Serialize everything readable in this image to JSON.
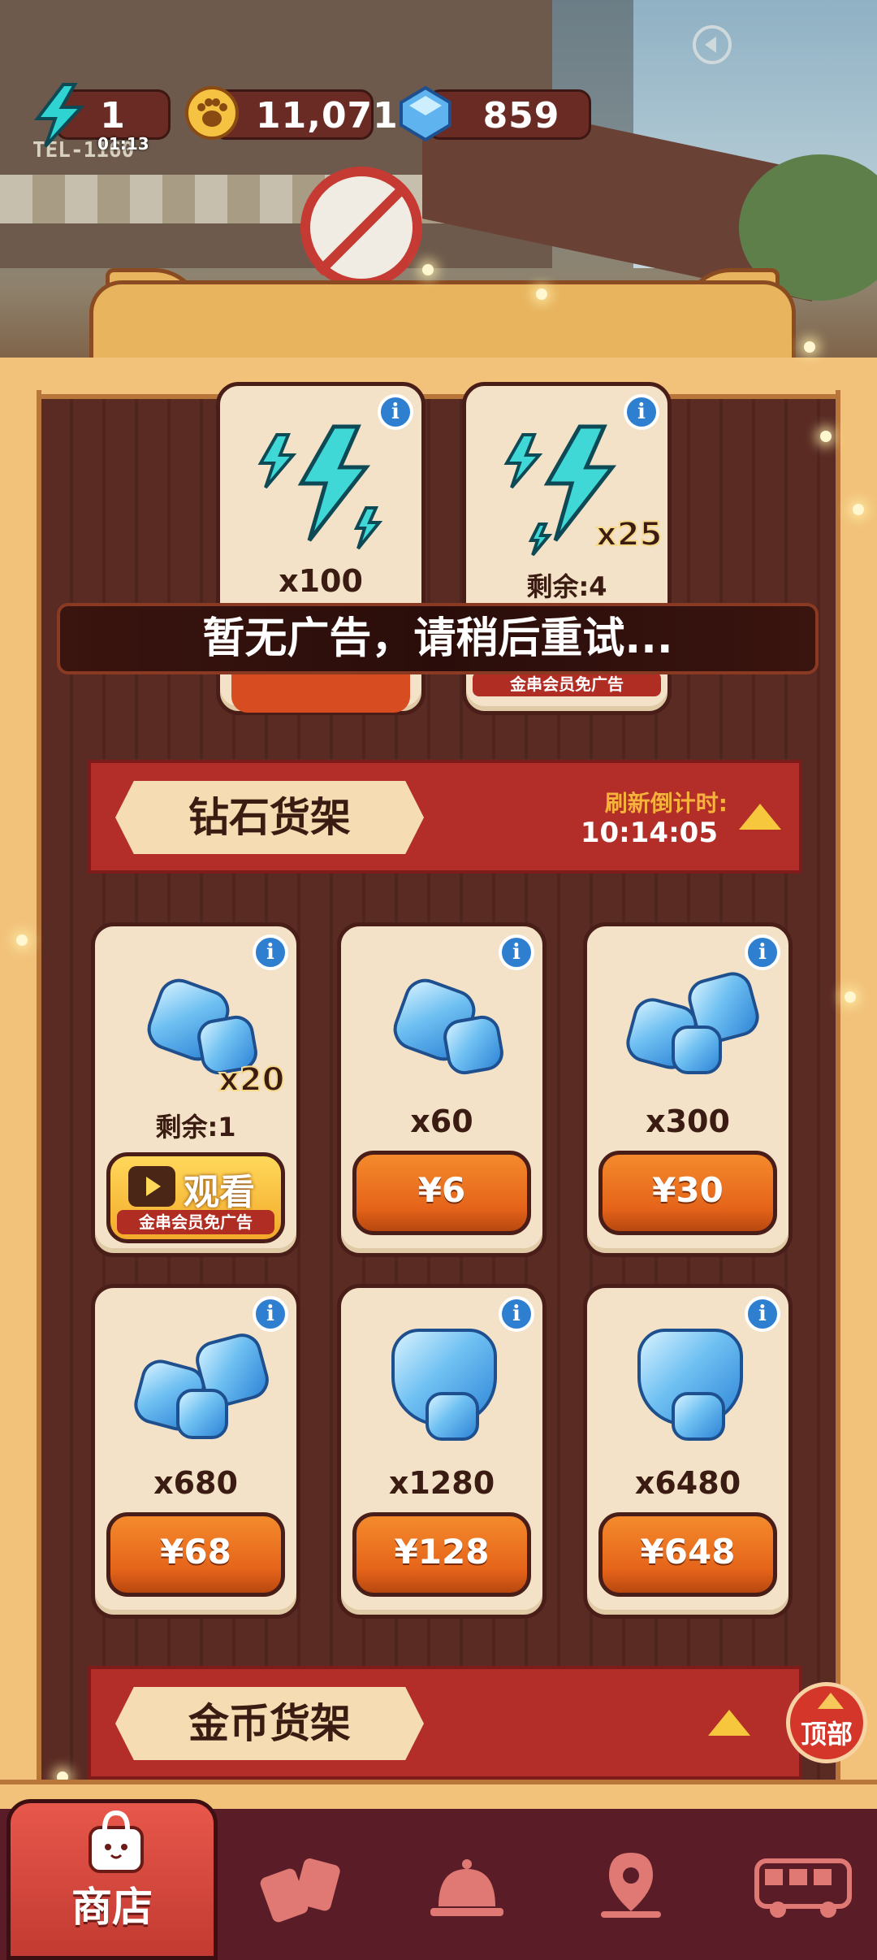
{
  "hud": {
    "energy": {
      "value": "1",
      "timer": "01:13",
      "icon": "lightning-icon"
    },
    "coins": {
      "value": "11,071",
      "icon": "paw-coin-icon"
    },
    "gems": {
      "value": "859",
      "icon": "gem-icon"
    }
  },
  "scene": {
    "sign_text": "TEL-1160"
  },
  "energy_shelf": {
    "cards": [
      {
        "amount": "x100",
        "icon": "lightning-bundle-icon"
      },
      {
        "multiplier": "x25",
        "remaining": "剩余:4",
        "vip_note": "金串会员免广告",
        "icon": "lightning-bundle-icon"
      }
    ]
  },
  "toast": {
    "message": "暂无广告，请稍后重试..."
  },
  "diamond_shelf": {
    "title": "钻石货架",
    "refresh_label": "刷新倒计时:",
    "refresh_time": "10:14:05",
    "cards": [
      {
        "multiplier": "x20",
        "remaining": "剩余:1",
        "action": "观看",
        "vip_note": "金串会员免广告"
      },
      {
        "amount": "x60",
        "price": "¥6"
      },
      {
        "amount": "x300",
        "price": "¥30"
      },
      {
        "amount": "x680",
        "price": "¥68"
      },
      {
        "amount": "x1280",
        "price": "¥128"
      },
      {
        "amount": "x6480",
        "price": "¥648"
      }
    ]
  },
  "coin_shelf": {
    "title": "金币货架"
  },
  "top_button": {
    "label": "顶部"
  },
  "nav": {
    "items": [
      {
        "label": "商店",
        "icon": "shop-bag-icon",
        "active": true
      },
      {
        "label": "",
        "icon": "cards-icon"
      },
      {
        "label": "",
        "icon": "service-bell-icon"
      },
      {
        "label": "",
        "icon": "map-pin-icon"
      },
      {
        "label": "",
        "icon": "bus-icon"
      }
    ]
  },
  "colors": {
    "panel": "#5a2b23",
    "banner": "#b32d29",
    "button": "#e5641a",
    "gem": "#6fc0f2"
  }
}
